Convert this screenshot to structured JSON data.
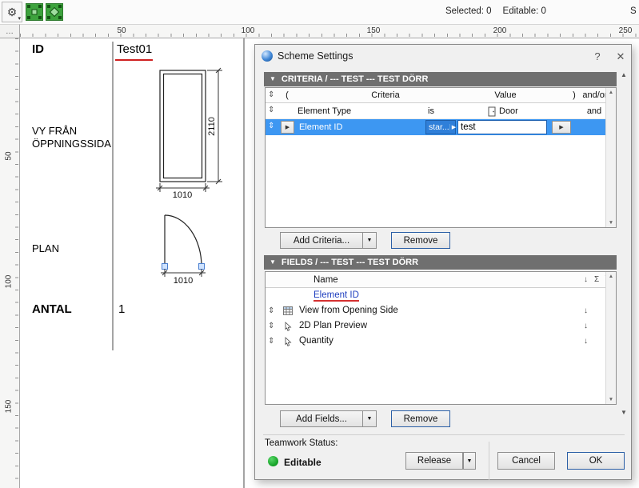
{
  "colors": {
    "selection_blue": "#3d97f2",
    "section_header_gray": "#6f6f6f",
    "status_green": "#129f24",
    "spellcheck_red": "#cf2020"
  },
  "icons": {
    "gear": "⚙",
    "dropdown_small": "▾",
    "dropdown": "▼",
    "collapse": "▼",
    "expand_right": "▶",
    "drag": "⇕",
    "sort_down": "↓",
    "sum": "Σ",
    "flag": "⚑",
    "scroll_up": "▲",
    "scroll_down": "▼",
    "help": "?",
    "close": "✕",
    "corner_ellipsis": "…"
  },
  "toolbar": {
    "selected": "Selected: 0",
    "editable": "Editable: 0",
    "truncated": "S"
  },
  "rulers": {
    "h": [
      "50",
      "100",
      "150",
      "200",
      "250"
    ],
    "v": [
      "50",
      "100",
      "150"
    ]
  },
  "schedule": {
    "id_label": "ID",
    "id_value": "Test01",
    "view_line1": "VY FRÅN",
    "view_line2": "ÖPPNINGSSIDA",
    "plan_label": "PLAN",
    "qty_label": "ANTAL",
    "qty_value": "1",
    "elev_height_dim": "2110",
    "elev_width_dim": "1010",
    "plan_width_dim": "1010"
  },
  "dialog": {
    "title": "Scheme Settings",
    "criteria": {
      "header": "CRITERIA / --- TEST --- TEST DÖRR",
      "col_open": "(",
      "col_criteria": "Criteria",
      "col_value": "Value",
      "col_close": ")",
      "col_andor": "and/or",
      "row1": {
        "name": "Element Type",
        "operator": "is",
        "value": "Door",
        "andor": "and"
      },
      "row2": {
        "name": "Element ID",
        "operator": "star...",
        "value": "test"
      },
      "add_button": "Add Criteria...",
      "remove_button": "Remove"
    },
    "fields": {
      "header": "FIELDS / --- TEST --- TEST DÖRR",
      "name_col": "Name",
      "rows": [
        {
          "label": "Element ID"
        },
        {
          "label": "View from Opening Side"
        },
        {
          "label": "2D Plan Preview"
        },
        {
          "label": "Quantity"
        }
      ],
      "add_button": "Add Fields...",
      "remove_button": "Remove"
    },
    "teamwork_label": "Teamwork Status:",
    "teamwork_status": "Editable",
    "release_button": "Release",
    "cancel_button": "Cancel",
    "ok_button": "OK"
  }
}
